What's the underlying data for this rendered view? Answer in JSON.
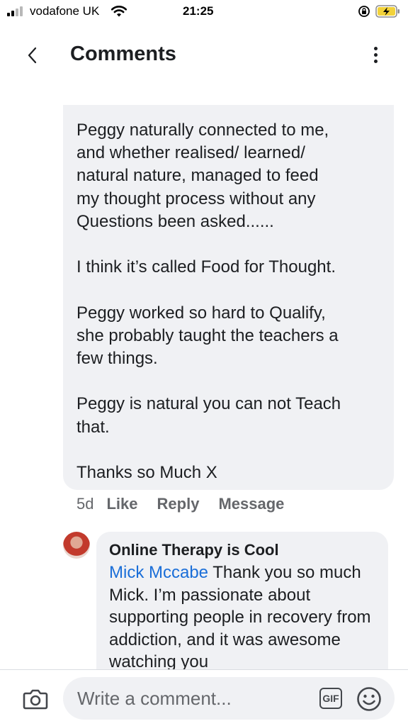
{
  "status_bar": {
    "carrier": "vodafone UK",
    "time": "21:25"
  },
  "header": {
    "title": "Comments"
  },
  "comment": {
    "paragraphs": [
      [
        "Peggy naturally connected to me,",
        "and whether realised/ learned/",
        "natural nature, managed to feed",
        "my thought process without any",
        "Questions been asked......"
      ],
      [
        "I think it’s called Food for Thought."
      ],
      [
        "Peggy  worked so hard to Qualify,",
        "she probably taught the teachers a",
        "few things."
      ],
      [
        "Peggy is natural you can not Teach",
        "that."
      ],
      [
        "Thanks so Much X"
      ]
    ],
    "age": "5d",
    "actions": [
      "Like",
      "Reply",
      "Message"
    ]
  },
  "reply": {
    "author": "Online Therapy is Cool",
    "mention": "Mick Mccabe",
    "text": " Thank you so much Mick. I’m passionate about supporting people in recovery from addiction, and it was awesome watching you"
  },
  "composer": {
    "placeholder": "Write a comment...",
    "gif_label": "GIF"
  }
}
